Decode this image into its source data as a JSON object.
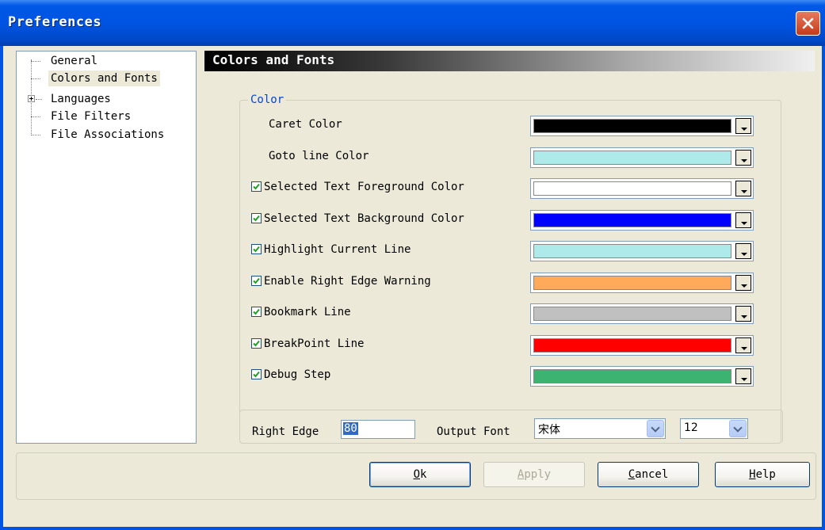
{
  "window": {
    "title": "Preferences"
  },
  "tree": {
    "items": [
      {
        "label": "General"
      },
      {
        "label": "Colors and Fonts",
        "selected": true
      },
      {
        "label": "Languages",
        "expandable": true
      },
      {
        "label": "File Filters"
      },
      {
        "label": "File Associations"
      }
    ]
  },
  "panel": {
    "header": "Colors and Fonts"
  },
  "color_group": {
    "legend": "Color",
    "rows": [
      {
        "label": "Caret Color",
        "checkbox": false,
        "color": "#000000"
      },
      {
        "label": "Goto line Color",
        "checkbox": false,
        "color": "#aeeaea"
      },
      {
        "label": "Selected Text Foreground Color",
        "checkbox": true,
        "checked": true,
        "color": "#ffffff"
      },
      {
        "label": "Selected Text Background Color",
        "checkbox": true,
        "checked": true,
        "color": "#0000ff"
      },
      {
        "label": "Highlight Current Line",
        "checkbox": true,
        "checked": true,
        "color": "#aeeaea"
      },
      {
        "label": "Enable Right Edge Warning",
        "checkbox": true,
        "checked": true,
        "color": "#ffaa5a"
      },
      {
        "label": "Bookmark Line",
        "checkbox": true,
        "checked": true,
        "color": "#c0c0c0"
      },
      {
        "label": "BreakPoint Line",
        "checkbox": true,
        "checked": true,
        "color": "#ff0000"
      },
      {
        "label": "Debug Step",
        "checkbox": true,
        "checked": true,
        "color": "#3cb371"
      }
    ]
  },
  "settings": {
    "right_edge_label": "Right Edge",
    "right_edge_value": "80",
    "output_font_label": "Output Font",
    "output_font_value": "宋体",
    "font_size_value": "12"
  },
  "buttons": {
    "ok": {
      "label": "Ok",
      "mnemonic": "O",
      "rest": "k"
    },
    "apply": {
      "label": "Apply",
      "mnemonic": "A",
      "rest": "pply"
    },
    "cancel": {
      "label": "Cancel",
      "mnemonic": "C",
      "rest": "ancel"
    },
    "help": {
      "label": "Help",
      "mnemonic": "H",
      "rest": "elp"
    }
  }
}
